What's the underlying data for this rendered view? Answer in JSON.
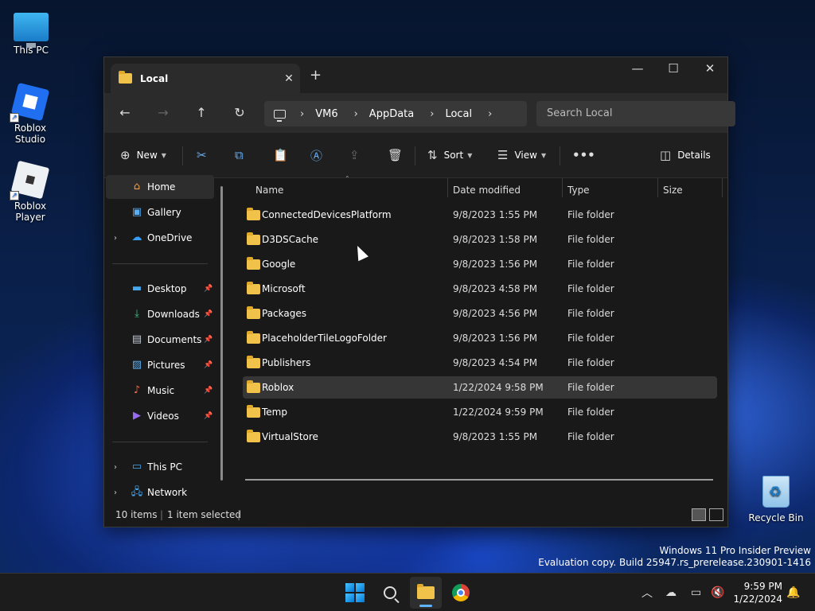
{
  "desktop": {
    "icons": [
      {
        "label": "This PC"
      },
      {
        "label": "Roblox Studio"
      },
      {
        "label": "Roblox Player"
      },
      {
        "label": "Recycle Bin"
      }
    ]
  },
  "window": {
    "tab_title": "Local",
    "address": {
      "segments": [
        "VM6",
        "AppData",
        "Local"
      ]
    },
    "search_placeholder": "Search Local",
    "commands": {
      "new": "New",
      "sort": "Sort",
      "view": "View",
      "details": "Details"
    },
    "sidebar": {
      "items": [
        {
          "label": "Home"
        },
        {
          "label": "Gallery"
        },
        {
          "label": "OneDrive"
        },
        {
          "label": "Desktop"
        },
        {
          "label": "Downloads"
        },
        {
          "label": "Documents"
        },
        {
          "label": "Pictures"
        },
        {
          "label": "Music"
        },
        {
          "label": "Videos"
        },
        {
          "label": "This PC"
        },
        {
          "label": "Network"
        }
      ]
    },
    "columns": {
      "name": "Name",
      "date": "Date modified",
      "type": "Type",
      "size": "Size"
    },
    "files": [
      {
        "name": "ConnectedDevicesPlatform",
        "date": "9/8/2023 1:55 PM",
        "type": "File folder"
      },
      {
        "name": "D3DSCache",
        "date": "9/8/2023 1:58 PM",
        "type": "File folder"
      },
      {
        "name": "Google",
        "date": "9/8/2023 1:56 PM",
        "type": "File folder"
      },
      {
        "name": "Microsoft",
        "date": "9/8/2023 4:58 PM",
        "type": "File folder"
      },
      {
        "name": "Packages",
        "date": "9/8/2023 4:56 PM",
        "type": "File folder"
      },
      {
        "name": "PlaceholderTileLogoFolder",
        "date": "9/8/2023 1:56 PM",
        "type": "File folder"
      },
      {
        "name": "Publishers",
        "date": "9/8/2023 4:54 PM",
        "type": "File folder"
      },
      {
        "name": "Roblox",
        "date": "1/22/2024 9:58 PM",
        "type": "File folder"
      },
      {
        "name": "Temp",
        "date": "1/22/2024 9:59 PM",
        "type": "File folder"
      },
      {
        "name": "VirtualStore",
        "date": "9/8/2023 1:55 PM",
        "type": "File folder"
      }
    ],
    "status": {
      "count": "10 items",
      "selected": "1 item selected"
    }
  },
  "watermark": {
    "line1": "Windows 11 Pro Insider Preview",
    "line2": "Evaluation copy. Build 25947.rs_prerelease.230901-1416"
  },
  "taskbar": {
    "time": "9:59 PM",
    "date": "1/22/2024"
  }
}
